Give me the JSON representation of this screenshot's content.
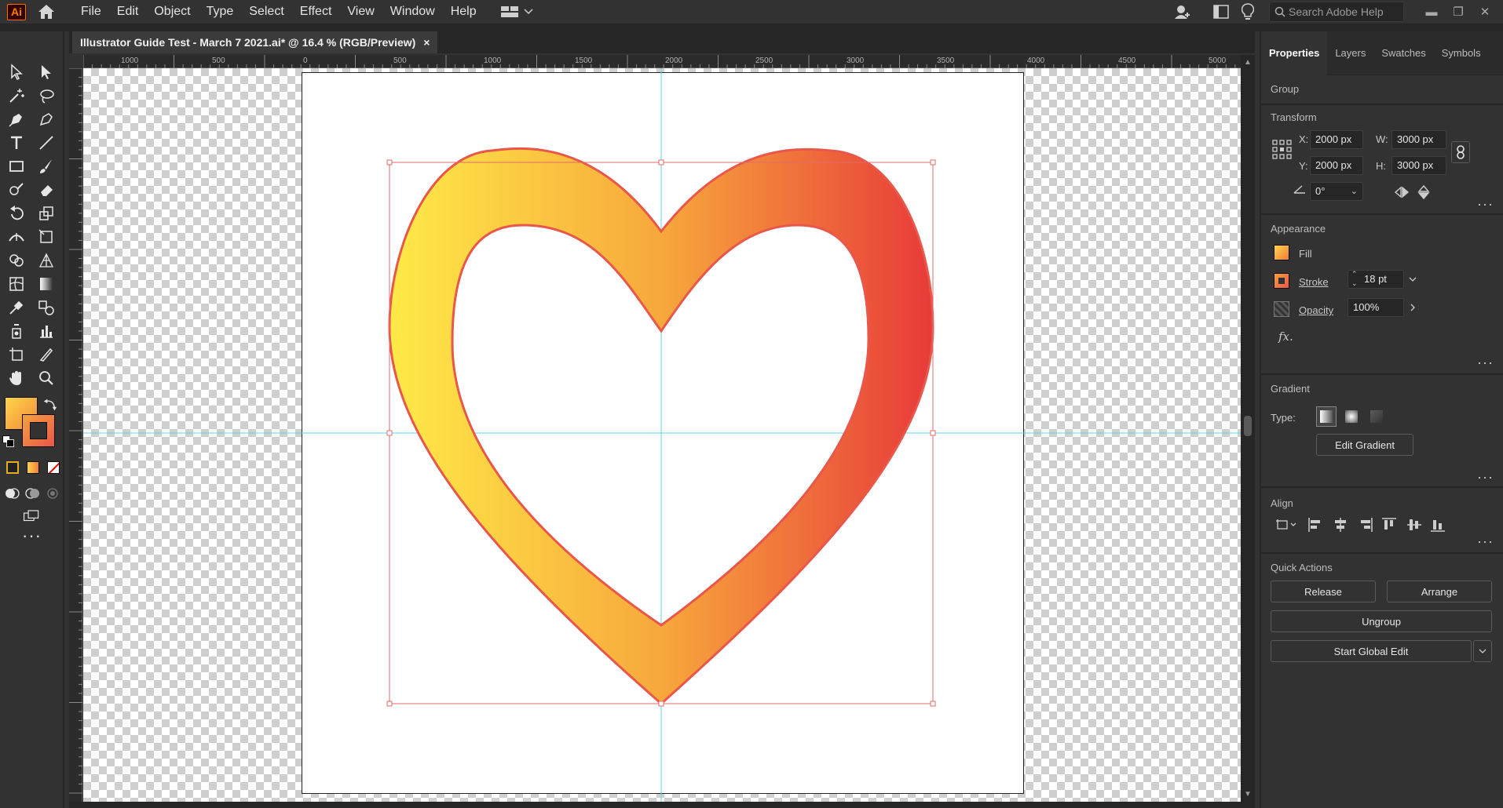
{
  "app": {
    "logo_text": "Ai"
  },
  "menu": [
    "File",
    "Edit",
    "Object",
    "Type",
    "Select",
    "Effect",
    "View",
    "Window",
    "Help"
  ],
  "search": {
    "placeholder": "Search Adobe Help"
  },
  "document": {
    "tab_title": "Illustrator Guide Test - March 7 2021.ai* @ 16.4 % (RGB/Preview)",
    "close": "×"
  },
  "ruler": {
    "top_ticks": [
      "1000",
      "500",
      "0",
      "500",
      "1000",
      "1500",
      "2000",
      "2500",
      "3000",
      "3500",
      "4000",
      "4500",
      "5000"
    ]
  },
  "panel": {
    "tabs": [
      "Properties",
      "Layers",
      "Swatches",
      "Symbols"
    ],
    "selection_type": "Group",
    "transform": {
      "title": "Transform",
      "x_label": "X:",
      "x": "2000 px",
      "y_label": "Y:",
      "y": "2000 px",
      "w_label": "W:",
      "w": "3000 px",
      "h_label": "H:",
      "h": "3000 px",
      "angle": "0°"
    },
    "appearance": {
      "title": "Appearance",
      "fill_label": "Fill",
      "stroke_label": "Stroke",
      "stroke_value": "18 pt",
      "opacity_label": "Opacity",
      "opacity_value": "100%",
      "fx_label": "fx."
    },
    "gradient": {
      "title": "Gradient",
      "type_label": "Type:",
      "edit_button": "Edit Gradient"
    },
    "align": {
      "title": "Align"
    },
    "quick_actions": {
      "title": "Quick Actions",
      "release": "Release",
      "arrange": "Arrange",
      "ungroup": "Ungroup",
      "global_edit": "Start Global Edit"
    }
  },
  "colors": {
    "accent_stroke": "#e8574a",
    "gradient_start": "#ffea47",
    "gradient_mid": "#f7a83c",
    "gradient_end": "#e83a3a",
    "guide": "#5fd7e0",
    "bbox": "#e26b6b"
  }
}
